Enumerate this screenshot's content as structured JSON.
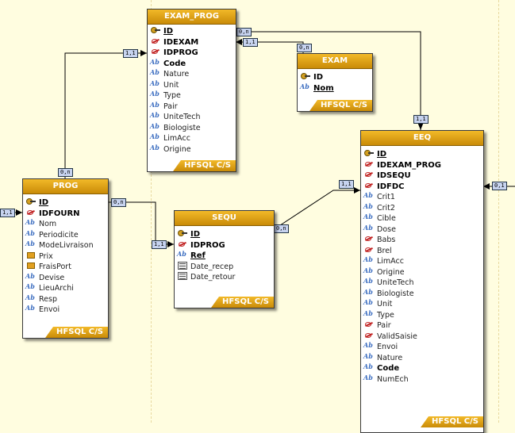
{
  "tables": {
    "exam_prog": {
      "title": "EXAM_PROG",
      "footer": "HFSQL C/S",
      "fields": [
        "ID",
        "IDEXAM",
        "IDPROG",
        "Code",
        "Nature",
        "Unit",
        "Type",
        "Pair",
        "UniteTech",
        "Biologiste",
        "LimAcc",
        "Origine"
      ]
    },
    "exam": {
      "title": "EXAM",
      "footer": "HFSQL C/S",
      "fields": [
        "ID",
        "Nom"
      ]
    },
    "prog": {
      "title": "PROG",
      "footer": "HFSQL C/S",
      "fields": [
        "ID",
        "IDFOURN",
        "Nom",
        "Periodicite",
        "ModeLivraison",
        "Prix",
        "FraisPort",
        "Devise",
        "LieuArchi",
        "Resp",
        "Envoi"
      ]
    },
    "sequ": {
      "title": "SEQU",
      "footer": "HFSQL C/S",
      "fields": [
        "ID",
        "IDPROG",
        "Ref",
        "Date_recep",
        "Date_retour"
      ]
    },
    "eeq": {
      "title": "EEQ",
      "footer": "HFSQL C/S",
      "fields": [
        "ID",
        "IDEXAM_PROG",
        "IDSEQU",
        "IDFDC",
        "Crit1",
        "Crit2",
        "Cible",
        "Dose",
        "Babs",
        "Brel",
        "LimAcc",
        "Origine",
        "UniteTech",
        "Biologiste",
        "Unit",
        "Type",
        "Pair",
        "ValidSaisie",
        "Envoi",
        "Nature",
        "Code",
        "NumEch"
      ]
    }
  },
  "cardinalities": {
    "exam_prog_eeq_left": "0,n",
    "exam_prog_eeq_right": "1,1",
    "exam_examprog_left": "1,1",
    "exam_examprog_right": "0,n",
    "prog_examprog_top": "1,1",
    "prog_examprog_bottom": "0,n",
    "prog_left": "1,1",
    "prog_sequ_left": "0,n",
    "prog_sequ_right": "1,1",
    "sequ_eeq_left": "0,n",
    "sequ_eeq_right": "1,1",
    "eeq_right": "0,1"
  }
}
